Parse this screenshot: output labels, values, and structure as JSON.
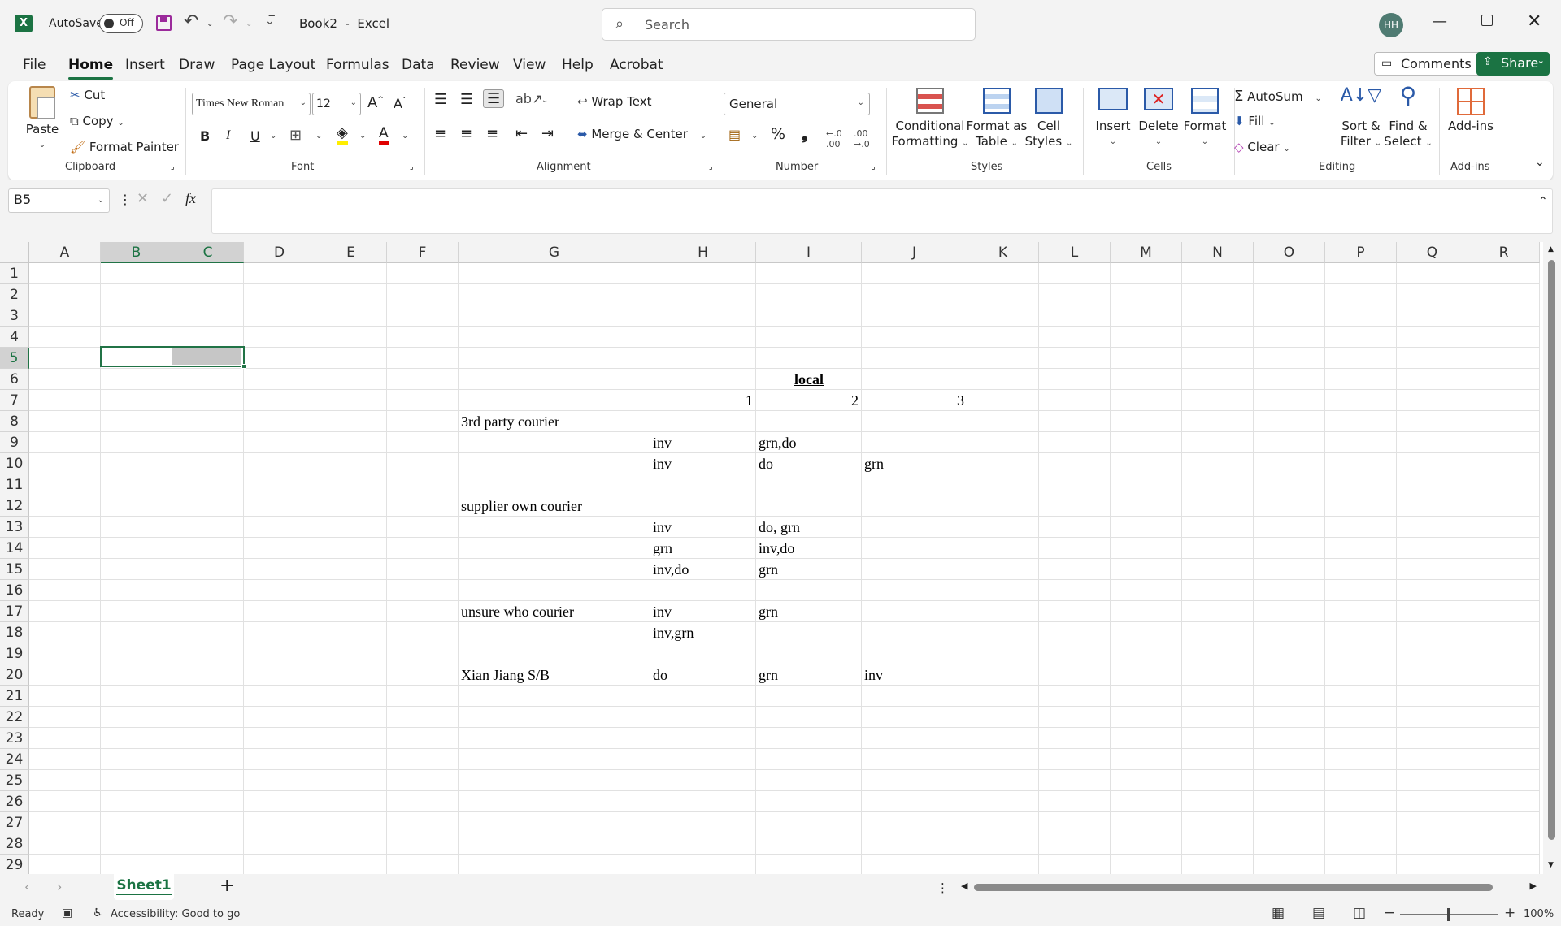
{
  "title_bar": {
    "autosave_label": "AutoSave",
    "autosave_state": "Off",
    "doc_title": "Book2  -  Excel",
    "search_placeholder": "Search",
    "user_initials": "HH"
  },
  "menu": {
    "tabs": [
      "File",
      "Home",
      "Insert",
      "Draw",
      "Page Layout",
      "Formulas",
      "Data",
      "Review",
      "View",
      "Help",
      "Acrobat"
    ],
    "active_tab": "Home",
    "comments_label": "Comments",
    "share_label": "Share"
  },
  "ribbon": {
    "clipboard": {
      "paste": "Paste",
      "cut": "Cut",
      "copy": "Copy",
      "format_painter": "Format Painter",
      "group": "Clipboard"
    },
    "font": {
      "name": "Times New Roman",
      "size": "12",
      "group": "Font",
      "bold": "B",
      "italic": "I",
      "underline": "U"
    },
    "alignment": {
      "wrap_text": "Wrap Text",
      "merge_center": "Merge & Center",
      "group": "Alignment"
    },
    "number": {
      "format": "General",
      "group": "Number"
    },
    "styles": {
      "conditional_1": "Conditional",
      "conditional_2": "Formatting",
      "format_table_1": "Format as",
      "format_table_2": "Table",
      "cell_styles_1": "Cell",
      "cell_styles_2": "Styles",
      "group": "Styles"
    },
    "cells": {
      "insert": "Insert",
      "delete": "Delete",
      "format": "Format",
      "group": "Cells"
    },
    "editing": {
      "autosum": "AutoSum",
      "fill": "Fill",
      "clear": "Clear",
      "sort_1": "Sort &",
      "sort_2": "Filter",
      "find_1": "Find &",
      "find_2": "Select",
      "group": "Editing"
    },
    "addins": {
      "label": "Add-ins",
      "group": "Add-ins"
    }
  },
  "formula_bar": {
    "name_box": "B5",
    "fx": "fx",
    "content": ""
  },
  "columns": [
    "A",
    "B",
    "C",
    "D",
    "E",
    "F",
    "G",
    "H",
    "I",
    "J",
    "K",
    "L",
    "M",
    "N",
    "O",
    "P",
    "Q",
    "R"
  ],
  "rows": [
    "1",
    "2",
    "3",
    "4",
    "5",
    "6",
    "7",
    "8",
    "9",
    "10",
    "11",
    "12",
    "13",
    "14",
    "15",
    "16",
    "17",
    "18",
    "19",
    "20",
    "21",
    "22",
    "23",
    "24",
    "25",
    "26",
    "27",
    "28",
    "29"
  ],
  "cells": {
    "I6": "local",
    "H7": "1",
    "I7": "2",
    "J7": "3",
    "G8": "3rd party courier",
    "H9": "inv",
    "I9": "grn,do",
    "H10": "inv",
    "I10": "do",
    "J10": "grn",
    "G12": "supplier own courier",
    "H13": "inv",
    "I13": "do, grn",
    "H14": "grn",
    "I14": "inv,do",
    "H15": "inv,do",
    "I15": "grn",
    "G17": "unsure who courier",
    "H17": "inv",
    "I17": "grn",
    "H18": "inv,grn",
    "G20": "Xian Jiang S/B",
    "H20": "do",
    "I20": "grn",
    "J20": "inv"
  },
  "sheets": {
    "active": "Sheet1"
  },
  "status": {
    "ready": "Ready",
    "accessibility": "Accessibility: Good to go",
    "zoom": "100%"
  },
  "colors": {
    "accent": "#1b7343",
    "selection": "#217346"
  }
}
